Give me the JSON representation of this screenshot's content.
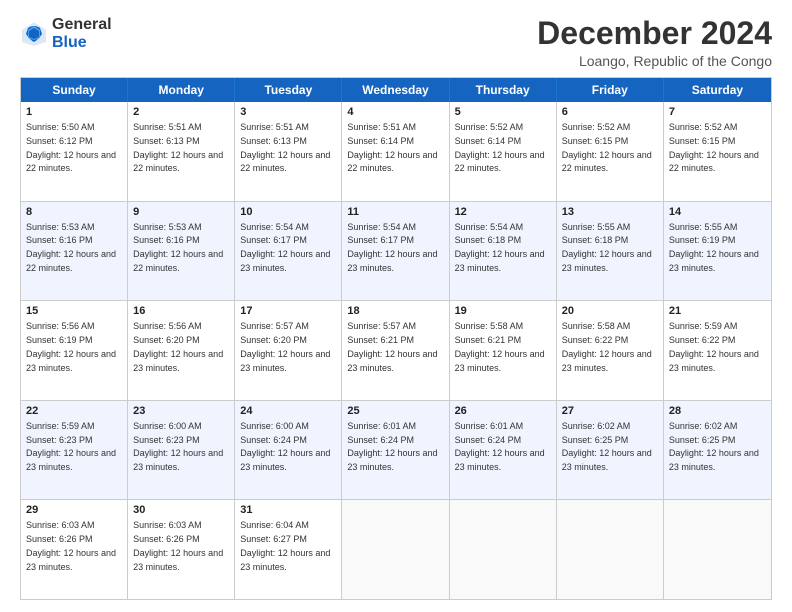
{
  "logo": {
    "line1": "General",
    "line2": "Blue"
  },
  "title": "December 2024",
  "subtitle": "Loango, Republic of the Congo",
  "days": [
    "Sunday",
    "Monday",
    "Tuesday",
    "Wednesday",
    "Thursday",
    "Friday",
    "Saturday"
  ],
  "rows": [
    [
      {
        "day": "1",
        "sunrise": "5:50 AM",
        "sunset": "6:12 PM",
        "daylight": "12 hours and 22 minutes."
      },
      {
        "day": "2",
        "sunrise": "5:51 AM",
        "sunset": "6:13 PM",
        "daylight": "12 hours and 22 minutes."
      },
      {
        "day": "3",
        "sunrise": "5:51 AM",
        "sunset": "6:13 PM",
        "daylight": "12 hours and 22 minutes."
      },
      {
        "day": "4",
        "sunrise": "5:51 AM",
        "sunset": "6:14 PM",
        "daylight": "12 hours and 22 minutes."
      },
      {
        "day": "5",
        "sunrise": "5:52 AM",
        "sunset": "6:14 PM",
        "daylight": "12 hours and 22 minutes."
      },
      {
        "day": "6",
        "sunrise": "5:52 AM",
        "sunset": "6:15 PM",
        "daylight": "12 hours and 22 minutes."
      },
      {
        "day": "7",
        "sunrise": "5:52 AM",
        "sunset": "6:15 PM",
        "daylight": "12 hours and 22 minutes."
      }
    ],
    [
      {
        "day": "8",
        "sunrise": "5:53 AM",
        "sunset": "6:16 PM",
        "daylight": "12 hours and 22 minutes."
      },
      {
        "day": "9",
        "sunrise": "5:53 AM",
        "sunset": "6:16 PM",
        "daylight": "12 hours and 22 minutes."
      },
      {
        "day": "10",
        "sunrise": "5:54 AM",
        "sunset": "6:17 PM",
        "daylight": "12 hours and 23 minutes."
      },
      {
        "day": "11",
        "sunrise": "5:54 AM",
        "sunset": "6:17 PM",
        "daylight": "12 hours and 23 minutes."
      },
      {
        "day": "12",
        "sunrise": "5:54 AM",
        "sunset": "6:18 PM",
        "daylight": "12 hours and 23 minutes."
      },
      {
        "day": "13",
        "sunrise": "5:55 AM",
        "sunset": "6:18 PM",
        "daylight": "12 hours and 23 minutes."
      },
      {
        "day": "14",
        "sunrise": "5:55 AM",
        "sunset": "6:19 PM",
        "daylight": "12 hours and 23 minutes."
      }
    ],
    [
      {
        "day": "15",
        "sunrise": "5:56 AM",
        "sunset": "6:19 PM",
        "daylight": "12 hours and 23 minutes."
      },
      {
        "day": "16",
        "sunrise": "5:56 AM",
        "sunset": "6:20 PM",
        "daylight": "12 hours and 23 minutes."
      },
      {
        "day": "17",
        "sunrise": "5:57 AM",
        "sunset": "6:20 PM",
        "daylight": "12 hours and 23 minutes."
      },
      {
        "day": "18",
        "sunrise": "5:57 AM",
        "sunset": "6:21 PM",
        "daylight": "12 hours and 23 minutes."
      },
      {
        "day": "19",
        "sunrise": "5:58 AM",
        "sunset": "6:21 PM",
        "daylight": "12 hours and 23 minutes."
      },
      {
        "day": "20",
        "sunrise": "5:58 AM",
        "sunset": "6:22 PM",
        "daylight": "12 hours and 23 minutes."
      },
      {
        "day": "21",
        "sunrise": "5:59 AM",
        "sunset": "6:22 PM",
        "daylight": "12 hours and 23 minutes."
      }
    ],
    [
      {
        "day": "22",
        "sunrise": "5:59 AM",
        "sunset": "6:23 PM",
        "daylight": "12 hours and 23 minutes."
      },
      {
        "day": "23",
        "sunrise": "6:00 AM",
        "sunset": "6:23 PM",
        "daylight": "12 hours and 23 minutes."
      },
      {
        "day": "24",
        "sunrise": "6:00 AM",
        "sunset": "6:24 PM",
        "daylight": "12 hours and 23 minutes."
      },
      {
        "day": "25",
        "sunrise": "6:01 AM",
        "sunset": "6:24 PM",
        "daylight": "12 hours and 23 minutes."
      },
      {
        "day": "26",
        "sunrise": "6:01 AM",
        "sunset": "6:24 PM",
        "daylight": "12 hours and 23 minutes."
      },
      {
        "day": "27",
        "sunrise": "6:02 AM",
        "sunset": "6:25 PM",
        "daylight": "12 hours and 23 minutes."
      },
      {
        "day": "28",
        "sunrise": "6:02 AM",
        "sunset": "6:25 PM",
        "daylight": "12 hours and 23 minutes."
      }
    ],
    [
      {
        "day": "29",
        "sunrise": "6:03 AM",
        "sunset": "6:26 PM",
        "daylight": "12 hours and 23 minutes."
      },
      {
        "day": "30",
        "sunrise": "6:03 AM",
        "sunset": "6:26 PM",
        "daylight": "12 hours and 23 minutes."
      },
      {
        "day": "31",
        "sunrise": "6:04 AM",
        "sunset": "6:27 PM",
        "daylight": "12 hours and 23 minutes."
      },
      null,
      null,
      null,
      null
    ]
  ]
}
